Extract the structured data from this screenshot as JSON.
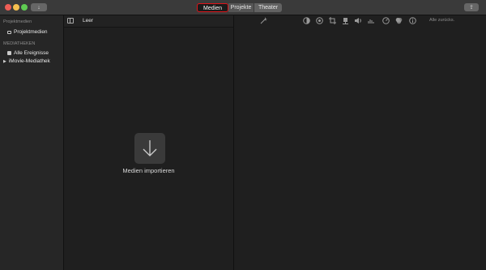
{
  "titlebar": {
    "tabs": [
      {
        "label": "Medien",
        "selected": true
      },
      {
        "label": "Projekte",
        "selected": false
      },
      {
        "label": "Theater",
        "selected": false
      }
    ],
    "highlight_color": "#e0141a"
  },
  "sidebar": {
    "section_projects": "Projektmedien",
    "item_project_media": "Projektmedien",
    "section_libraries": "MEDIATHEKEN",
    "item_all_events": "Alle Ereignisse",
    "item_library": "iMovie-Mediathek"
  },
  "browser": {
    "title": "Leer",
    "import_label": "Medien importieren"
  },
  "viewer": {
    "reset_label": "Alle zurücks.",
    "tool_icons": [
      "magic-wand-icon",
      "color-balance-icon",
      "color-correction-icon",
      "crop-icon",
      "stabilization-icon",
      "volume-icon",
      "noise-reduction-icon",
      "speed-icon",
      "clip-filter-icon",
      "info-icon"
    ]
  }
}
